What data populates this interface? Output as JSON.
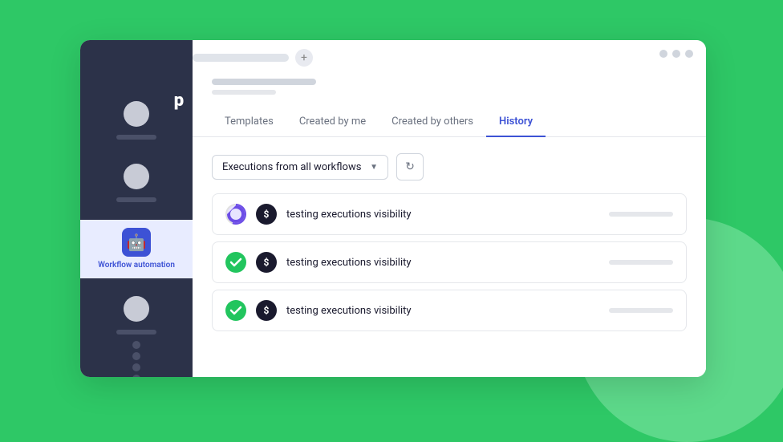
{
  "window": {
    "chrome_dots": [
      "dot1",
      "dot2",
      "dot3"
    ]
  },
  "sidebar": {
    "logo": "p",
    "items": [
      {
        "id": "item-1",
        "type": "avatar-item"
      },
      {
        "id": "item-2",
        "type": "avatar-item"
      },
      {
        "id": "item-3",
        "type": "avatar-item"
      }
    ],
    "workflow": {
      "label": "Workflow\nautomation",
      "icon": "🤖"
    },
    "more_dots": "..."
  },
  "tabs": {
    "items": [
      {
        "id": "tab-templates",
        "label": "Templates",
        "active": false
      },
      {
        "id": "tab-created-by-me",
        "label": "Created by me",
        "active": false
      },
      {
        "id": "tab-created-by-others",
        "label": "Created by others",
        "active": false
      },
      {
        "id": "tab-history",
        "label": "History",
        "active": true
      }
    ]
  },
  "filter": {
    "dropdown_label": "Executions from all workflows",
    "dropdown_placeholder": "Executions from all workflows",
    "refresh_icon": "↻"
  },
  "executions": [
    {
      "id": "exec-1",
      "name": "testing executions visibility",
      "status": "running"
    },
    {
      "id": "exec-2",
      "name": "testing executions visibility",
      "status": "success"
    },
    {
      "id": "exec-3",
      "name": "testing executions visibility",
      "status": "success"
    }
  ]
}
